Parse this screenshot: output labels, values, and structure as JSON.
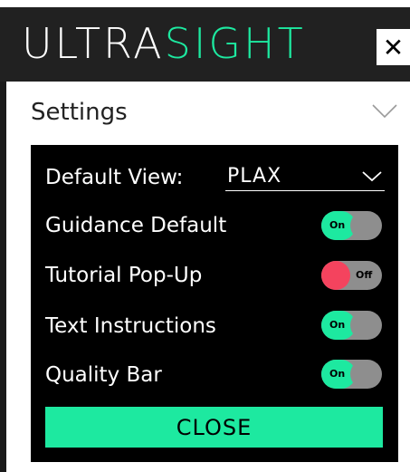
{
  "header": {
    "logo_part1": "ULTRA",
    "logo_part2": "SIGHT",
    "close_glyph": "✕",
    "close_icon": "close-icon"
  },
  "settings": {
    "title": "Settings",
    "collapse_icon": "chevron-down-icon"
  },
  "default_view": {
    "label": "Default View:",
    "value": "PLAX",
    "icon": "chevron-down-icon"
  },
  "toggles": [
    {
      "label": "Guidance Default",
      "state": "On"
    },
    {
      "label": "Tutorial Pop-Up",
      "state": "Off"
    },
    {
      "label": "Text Instructions",
      "state": "On"
    },
    {
      "label": "Quality Bar",
      "state": "On"
    }
  ],
  "close_button": {
    "label": "CLOSE"
  },
  "colors": {
    "accent": "#1de9a0",
    "off": "#f4435e",
    "header_bg": "#212121",
    "card_bg": "#000000"
  }
}
